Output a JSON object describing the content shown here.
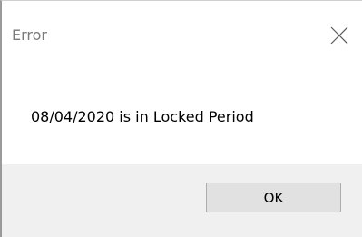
{
  "dialog": {
    "title": "Error",
    "close_icon": "close-icon",
    "message": "08/04/2020 is in Locked Period",
    "ok_label": "OK"
  }
}
